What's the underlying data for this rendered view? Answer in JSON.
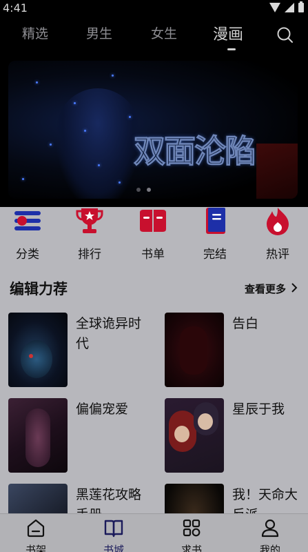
{
  "status": {
    "time": "4:41"
  },
  "tabs": [
    {
      "label": "精选"
    },
    {
      "label": "男生"
    },
    {
      "label": "女生"
    },
    {
      "label": "漫画"
    }
  ],
  "active_tab": "漫画",
  "banner": {
    "title": "双面沦陷",
    "pages": 2,
    "current_page": 2
  },
  "categories": [
    {
      "label": "分类",
      "icon": "list-icon"
    },
    {
      "label": "排行",
      "icon": "trophy-icon"
    },
    {
      "label": "书单",
      "icon": "open-book-icon"
    },
    {
      "label": "完结",
      "icon": "book-icon"
    },
    {
      "label": "热评",
      "icon": "flame-icon"
    }
  ],
  "section": {
    "title": "编辑力荐",
    "more": "查看更多"
  },
  "books": [
    {
      "title": "全球诡异时代"
    },
    {
      "title": "告白"
    },
    {
      "title": "偏偏宠爱"
    },
    {
      "title": "星辰于我"
    },
    {
      "title": "黑莲花攻略手册"
    },
    {
      "title": "我！天命大反派"
    }
  ],
  "nav": [
    {
      "label": "书架",
      "icon": "home-icon"
    },
    {
      "label": "书城",
      "icon": "bookstore-icon"
    },
    {
      "label": "求书",
      "icon": "grid-icon"
    },
    {
      "label": "我的",
      "icon": "person-icon"
    }
  ],
  "active_nav": "书城",
  "colors": {
    "accent_red": "#c8102e",
    "accent_blue": "#1d2fa8",
    "nav_active": "#1a1a5a"
  }
}
